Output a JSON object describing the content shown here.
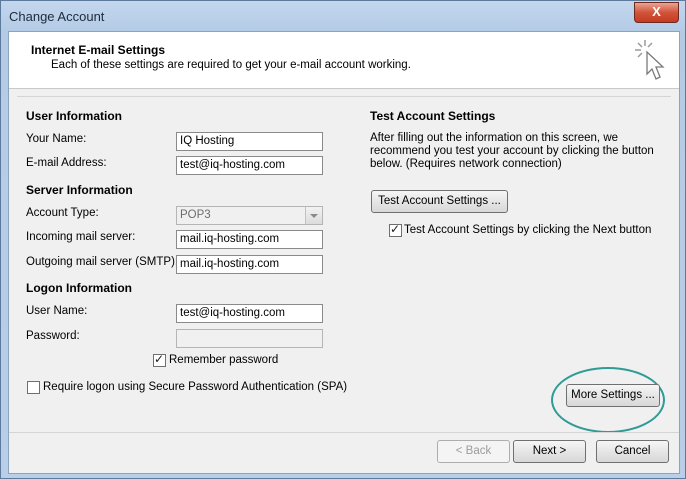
{
  "window": {
    "title": "Change Account",
    "close_label": "X"
  },
  "header": {
    "title": "Internet E-mail Settings",
    "subtitle": "Each of these settings are required to get your e-mail account working.",
    "icon": "cursor-sparkle-icon"
  },
  "user_info": {
    "heading": "User Information",
    "your_name_label": "Your Name:",
    "your_name_value": "IQ Hosting",
    "email_label": "E-mail Address:",
    "email_value": "test@iq-hosting.com"
  },
  "server_info": {
    "heading": "Server Information",
    "account_type_label": "Account Type:",
    "account_type_value": "POP3",
    "incoming_label": "Incoming mail server:",
    "incoming_value": "mail.iq-hosting.com",
    "outgoing_label": "Outgoing mail server (SMTP):",
    "outgoing_value": "mail.iq-hosting.com"
  },
  "logon_info": {
    "heading": "Logon Information",
    "username_label": "User Name:",
    "username_value": "test@iq-hosting.com",
    "password_label": "Password:",
    "password_value": "",
    "remember_label": "Remember password",
    "remember_checked": true,
    "spa_label": "Require logon using Secure Password Authentication (SPA)",
    "spa_checked": false
  },
  "test_settings": {
    "heading": "Test Account Settings",
    "description": "After filling out the information on this screen, we recommend you test your account by clicking the button below. (Requires network connection)",
    "test_button": "Test Account Settings ...",
    "auto_test_label": "Test Account Settings by clicking the Next button",
    "auto_test_checked": true
  },
  "buttons": {
    "more_settings": "More Settings ...",
    "back": "< Back",
    "next": "Next >",
    "cancel": "Cancel"
  },
  "colors": {
    "highlight_oval": "#2f9b96",
    "titlebar": "#b9cee8"
  }
}
